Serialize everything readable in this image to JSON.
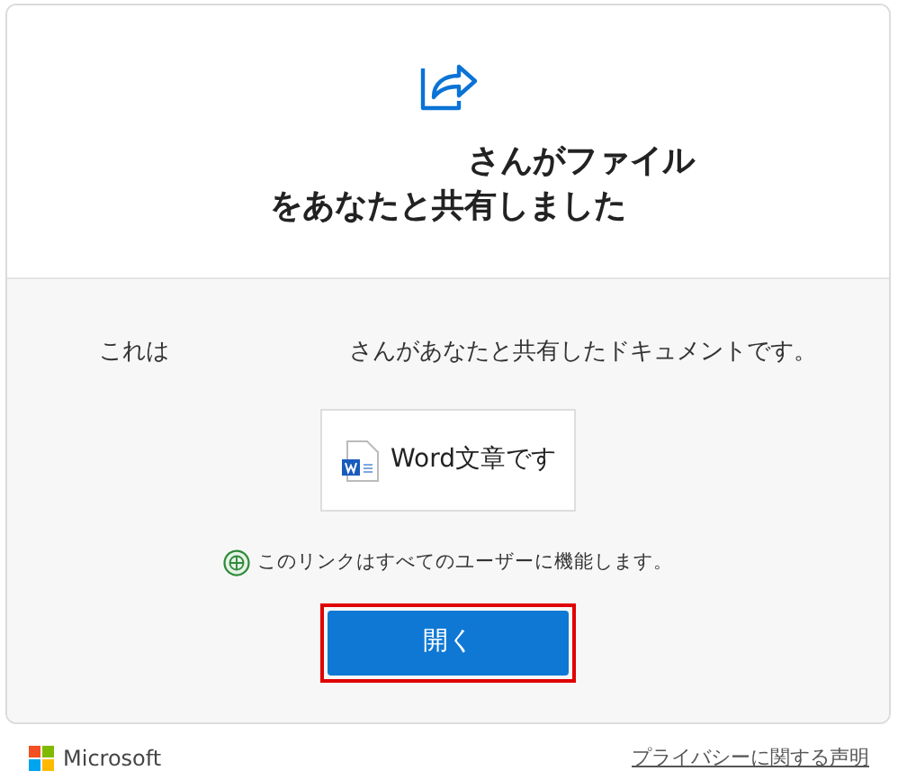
{
  "header": {
    "title_line_1": "さんがファイル",
    "title_line_2": "をあなたと共有しました"
  },
  "body": {
    "message_start": "これは",
    "message_end": "さんがあなたと共有したドキュメントです。",
    "document": {
      "kind": "word",
      "name": "Word文章です"
    },
    "link_note": "このリンクはすべてのユーザーに機能します。",
    "open_button": {
      "label": "開く",
      "highlighted": true
    }
  },
  "footer": {
    "brand": "Microsoft",
    "privacy_link": "プライバシーに関する声明"
  }
}
